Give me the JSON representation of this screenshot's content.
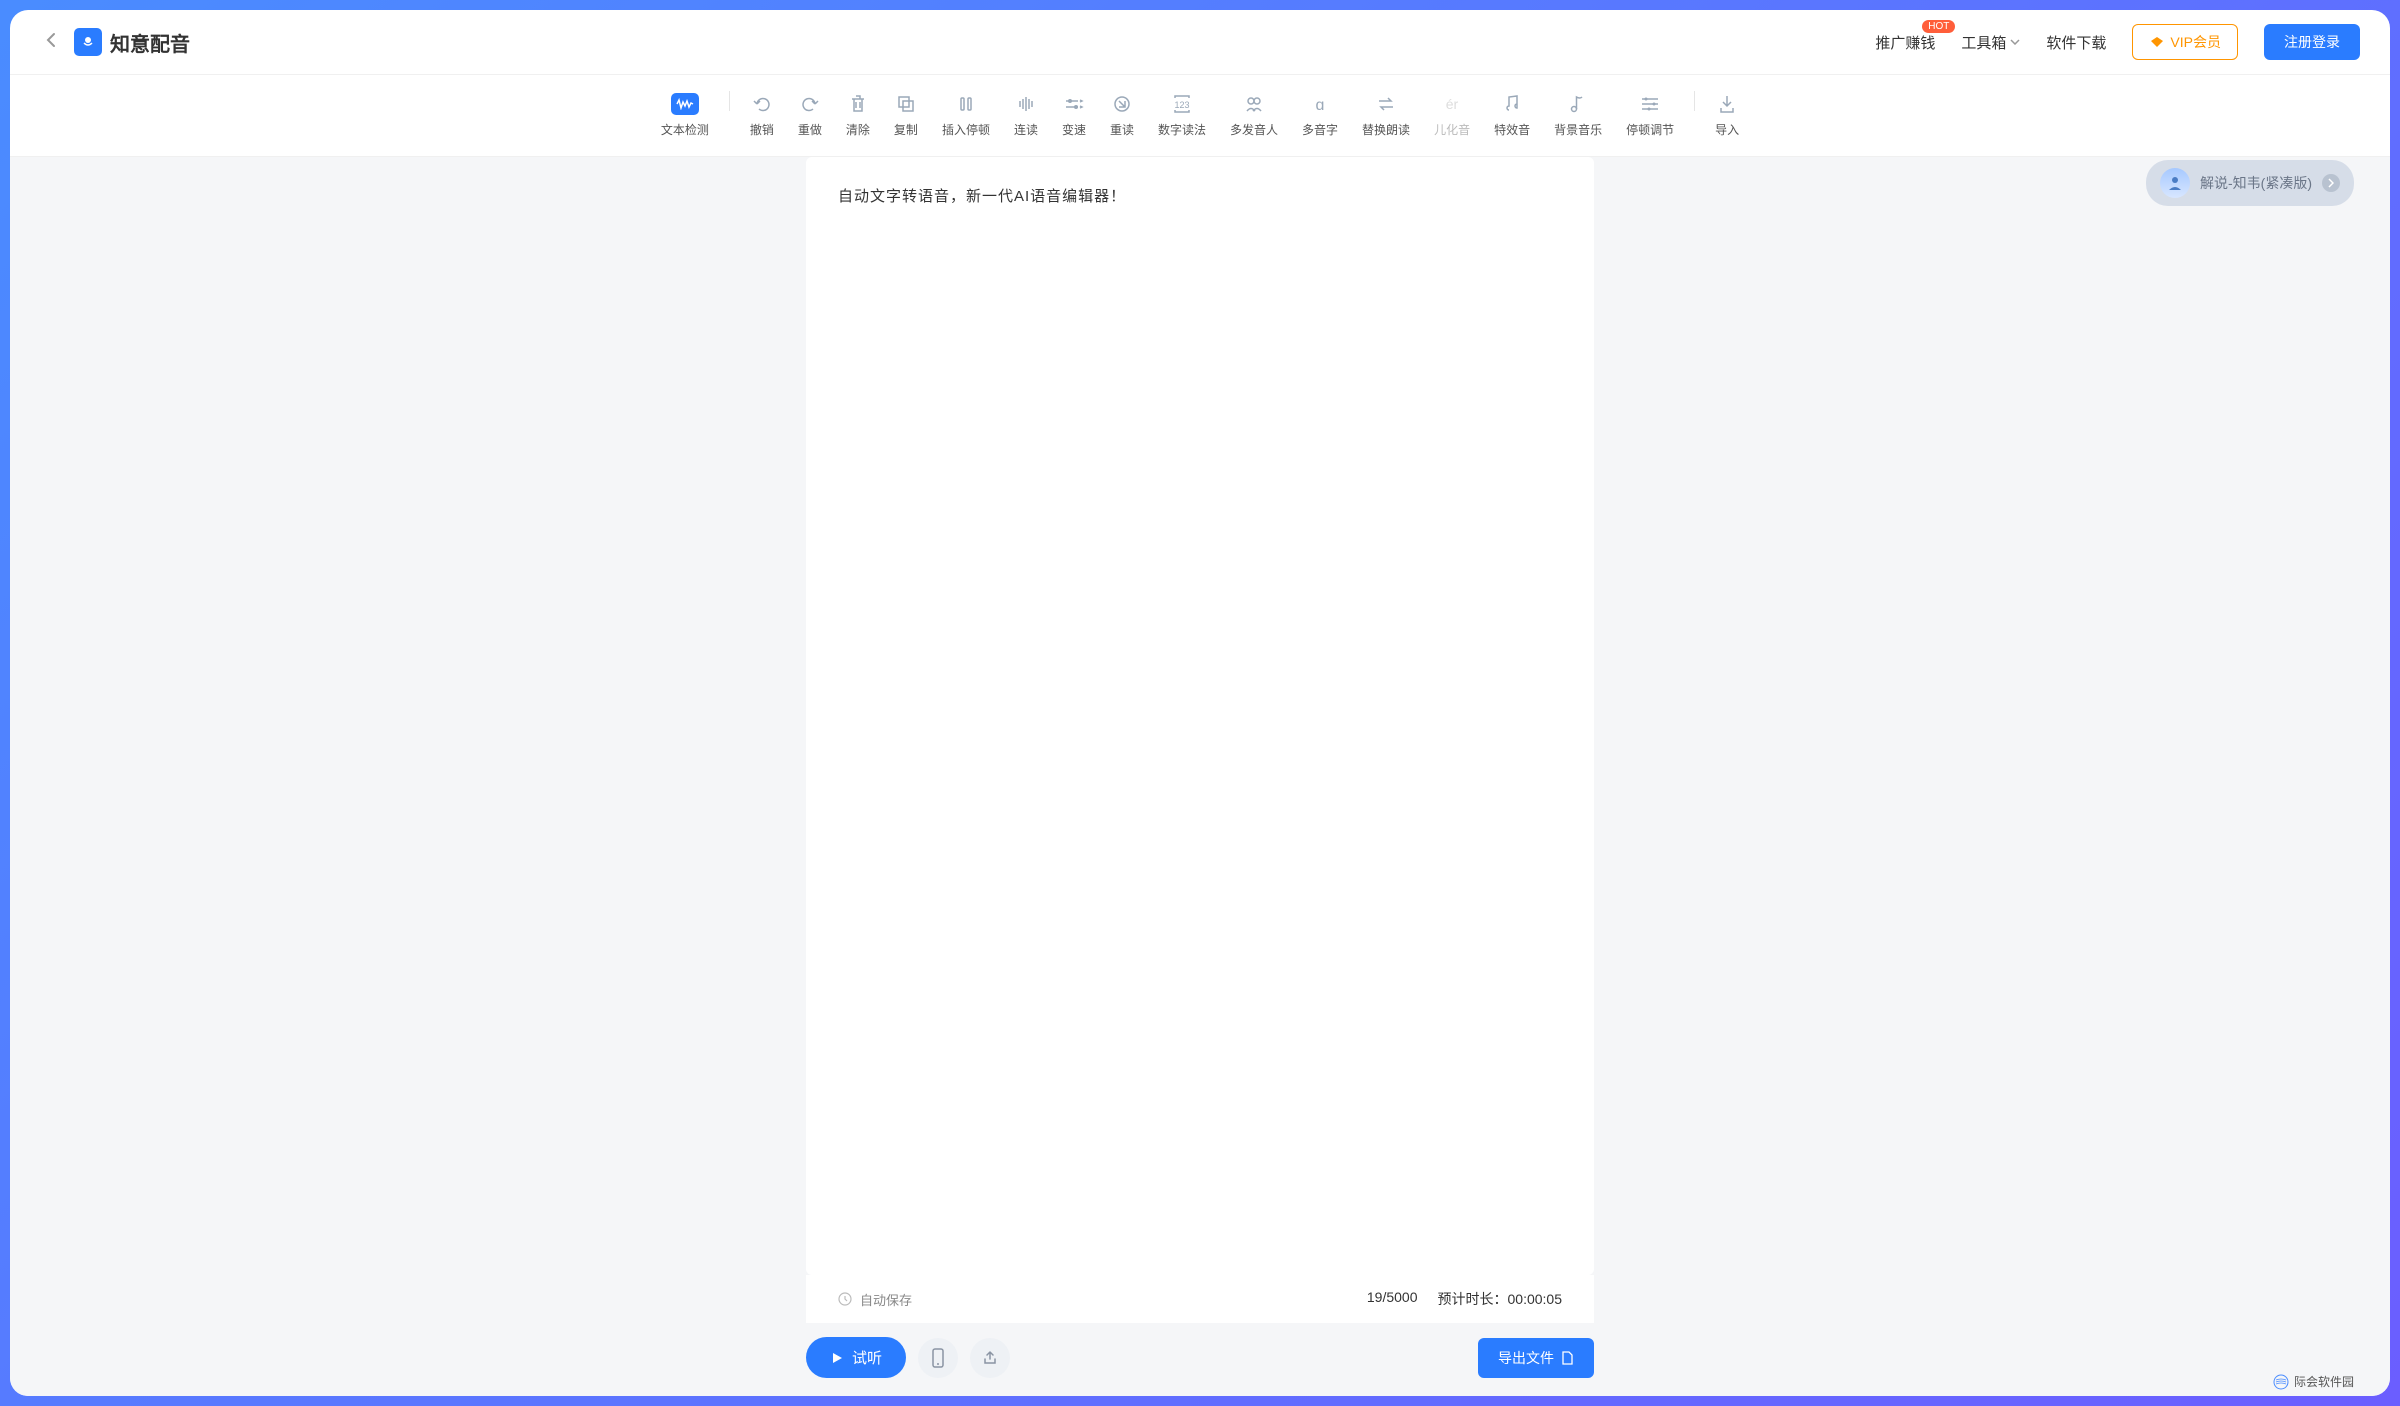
{
  "header": {
    "logo_text": "知意配音",
    "nav": {
      "promote": "推广赚钱",
      "promote_badge": "HOT",
      "toolbox": "工具箱",
      "download": "软件下载"
    },
    "vip_label": "VIP会员",
    "login_label": "注册登录"
  },
  "toolbar": [
    {
      "label": "文本检测",
      "icon": "waveform",
      "active": true
    },
    {
      "sep": true
    },
    {
      "label": "撤销",
      "icon": "undo"
    },
    {
      "label": "重做",
      "icon": "redo"
    },
    {
      "label": "清除",
      "icon": "trash"
    },
    {
      "label": "复制",
      "icon": "copy"
    },
    {
      "label": "插入停顿",
      "icon": "pause-insert"
    },
    {
      "label": "连读",
      "icon": "bars-vertical"
    },
    {
      "label": "变速",
      "icon": "speed"
    },
    {
      "label": "重读",
      "icon": "accent"
    },
    {
      "label": "数字读法",
      "icon": "number"
    },
    {
      "label": "多发音人",
      "icon": "multi-voice"
    },
    {
      "label": "多音字",
      "icon": "polyphonic"
    },
    {
      "label": "替换朗读",
      "icon": "replace"
    },
    {
      "label": "儿化音",
      "icon": "er",
      "disabled": true
    },
    {
      "label": "特效音",
      "icon": "music-note"
    },
    {
      "label": "背景音乐",
      "icon": "bg-music"
    },
    {
      "label": "停顿调节",
      "icon": "pause-adjust"
    },
    {
      "sep": true
    },
    {
      "label": "导入",
      "icon": "import"
    }
  ],
  "editor": {
    "content": "自动文字转语音，新一代AI语音编辑器！",
    "autosave_label": "自动保存",
    "char_count": "19/5000",
    "duration_label": "预计时长：",
    "duration_value": "00:00:05"
  },
  "actions": {
    "preview": "试听",
    "export": "导出文件"
  },
  "voice": {
    "label": "解说-知韦(紧凑版)"
  },
  "watermark": "际会软件园"
}
